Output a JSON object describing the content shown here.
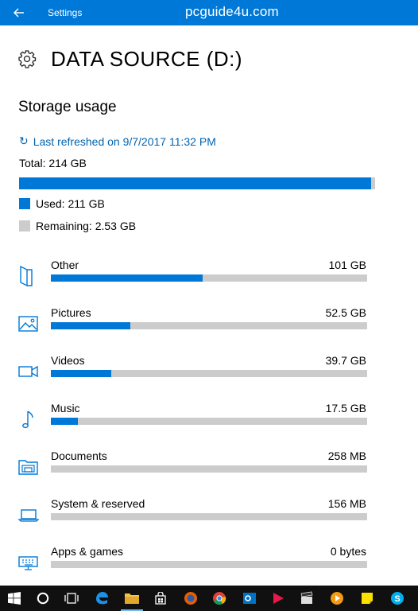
{
  "titlebar": {
    "app_title": "Settings",
    "watermark": "pcguide4u.com",
    "back_icon": "back-arrow-icon"
  },
  "page": {
    "title": "DATA SOURCE (D:)",
    "icon": "gear-icon"
  },
  "storage": {
    "heading": "Storage usage",
    "refresh_text": "Last refreshed on 9/7/2017 11:32 PM",
    "total_label": "Total: 214 GB",
    "used_fraction": 0.988,
    "used_label": "Used: 211 GB",
    "remaining_label": "Remaining: 2.53 GB"
  },
  "colors": {
    "accent": "#0078d7",
    "link": "#0063b1",
    "track": "#cccccc",
    "taskbar": "#101010"
  },
  "categories": [
    {
      "name": "Other",
      "size": "101 GB",
      "fraction": 0.48,
      "icon": "other-icon"
    },
    {
      "name": "Pictures",
      "size": "52.5 GB",
      "fraction": 0.25,
      "icon": "pictures-icon"
    },
    {
      "name": "Videos",
      "size": "39.7 GB",
      "fraction": 0.19,
      "icon": "videos-icon"
    },
    {
      "name": "Music",
      "size": "17.5 GB",
      "fraction": 0.085,
      "icon": "music-icon"
    },
    {
      "name": "Documents",
      "size": "258 MB",
      "fraction": 0,
      "icon": "documents-icon"
    },
    {
      "name": "System & reserved",
      "size": "156 MB",
      "fraction": 0,
      "icon": "system-icon"
    },
    {
      "name": "Apps & games",
      "size": "0 bytes",
      "fraction": 0,
      "icon": "apps-icon"
    }
  ],
  "taskbar": [
    {
      "name": "start-button",
      "icon": "windows-logo-icon"
    },
    {
      "name": "search-button",
      "icon": "cortana-circle-icon"
    },
    {
      "name": "task-view-button",
      "icon": "task-view-icon"
    },
    {
      "name": "edge-button",
      "icon": "edge-icon"
    },
    {
      "name": "file-explorer-button",
      "icon": "folder-icon"
    },
    {
      "name": "store-button",
      "icon": "store-bag-icon"
    },
    {
      "name": "firefox-button",
      "icon": "firefox-icon"
    },
    {
      "name": "chrome-button",
      "icon": "chrome-icon"
    },
    {
      "name": "outlook-button",
      "icon": "outlook-icon"
    },
    {
      "name": "media-button",
      "icon": "play-icon"
    },
    {
      "name": "movie-maker-button",
      "icon": "clapper-icon"
    },
    {
      "name": "media-player-button",
      "icon": "media-player-icon"
    },
    {
      "name": "sticky-notes-button",
      "icon": "sticky-note-icon"
    },
    {
      "name": "skype-button",
      "icon": "skype-icon"
    }
  ]
}
